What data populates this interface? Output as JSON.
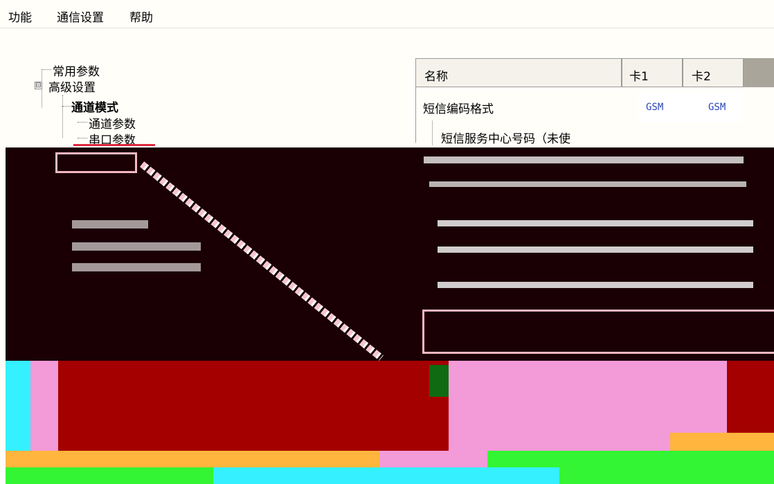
{
  "menu": {
    "items": [
      {
        "label": "功能"
      },
      {
        "label": "通信设置"
      },
      {
        "label": "帮助"
      }
    ]
  },
  "tree": {
    "items": [
      {
        "label": "常用参数"
      },
      {
        "label": "高级设置",
        "expander": "⊟"
      },
      {
        "label": "通道模式"
      },
      {
        "label": "通道参数"
      },
      {
        "label": "串口参数"
      }
    ]
  },
  "grid": {
    "columns": [
      {
        "label": "名称"
      },
      {
        "label": "卡1"
      },
      {
        "label": "卡2"
      }
    ],
    "rows": [
      {
        "name": "短信编码格式",
        "card1": "GSM",
        "card2": "GSM"
      },
      {
        "name": "短信服务中心号码（未使"
      }
    ]
  },
  "colors": {
    "background": "#fffef9",
    "dark": "#1a0005",
    "red": "#a50000",
    "pink": "#f39ad8",
    "cyan": "#35f0ff",
    "orange": "#ffb53e",
    "green": "#33f533",
    "link_blue": "#2a45b8"
  },
  "icons": {
    "tree_expander": "minus-box-icon"
  }
}
